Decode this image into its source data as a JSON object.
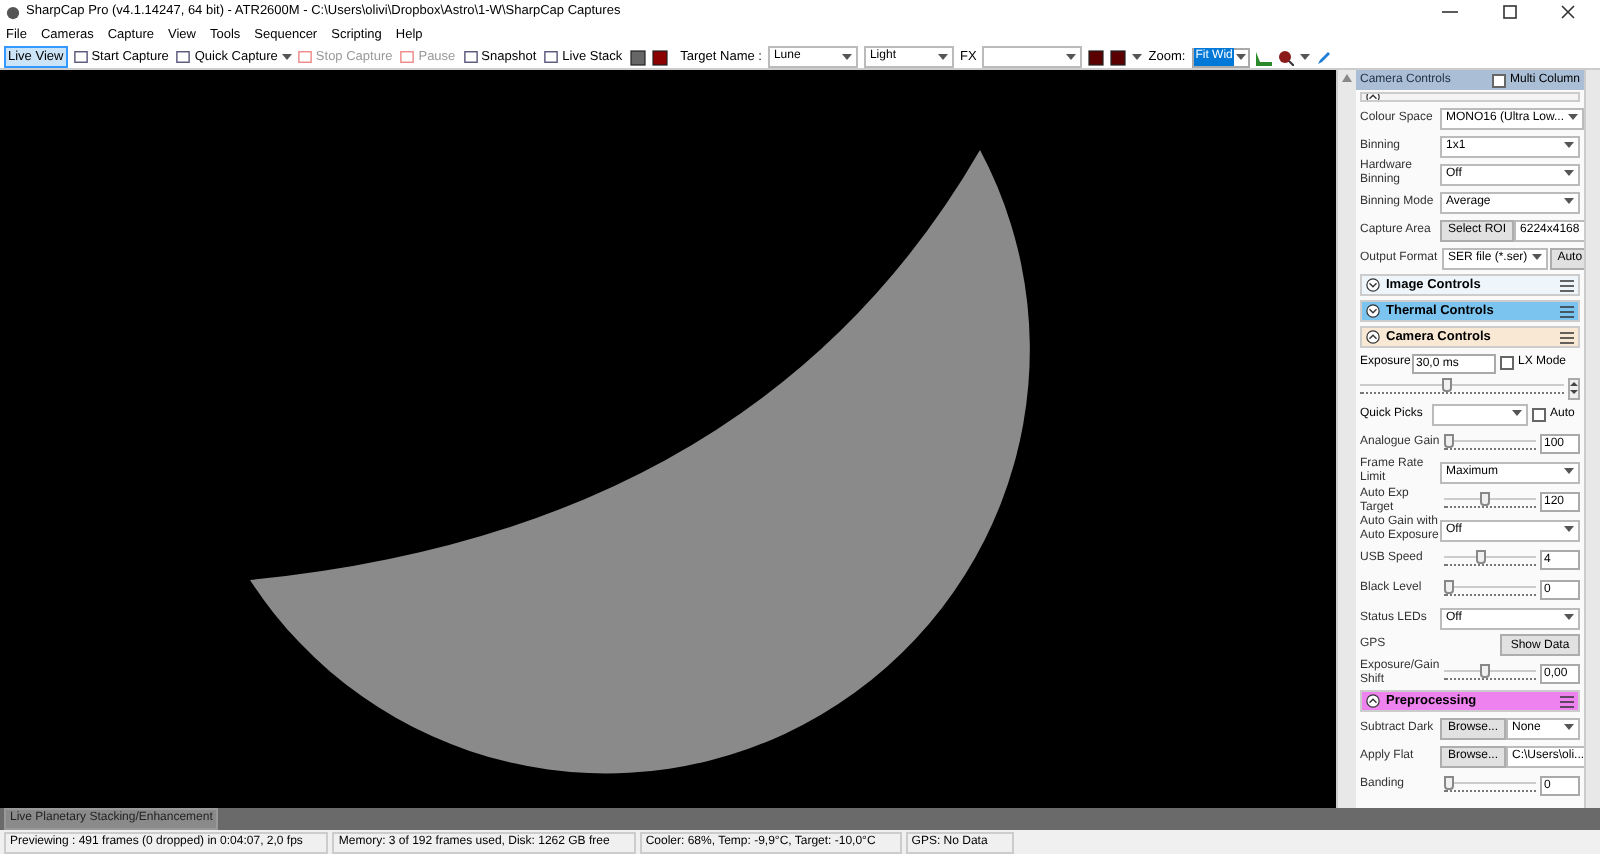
{
  "window": {
    "title": "SharpCap Pro (v4.1.14247, 64 bit) - ATR2600M - C:\\Users\\olivi\\Dropbox\\Astro\\1-W\\SharpCap Captures"
  },
  "menu": [
    "File",
    "Cameras",
    "Capture",
    "View",
    "Tools",
    "Sequencer",
    "Scripting",
    "Help"
  ],
  "toolbar": {
    "items": [
      {
        "kind": "tab",
        "label": "Live View",
        "selected": true,
        "disabled": false
      },
      {
        "kind": "button",
        "label": "Start Capture",
        "disabled": false
      },
      {
        "kind": "dropdown",
        "label": "Quick Capture",
        "disabled": false
      },
      {
        "kind": "button",
        "label": "Stop Capture",
        "disabled": true
      },
      {
        "kind": "button",
        "label": "Pause",
        "disabled": true
      },
      {
        "kind": "button",
        "label": "Snapshot",
        "disabled": false
      },
      {
        "kind": "button",
        "label": "Live Stack",
        "disabled": false
      }
    ],
    "target_label": "Target Name :",
    "target_value": "Lune",
    "frame_type": "Light",
    "fx_label": "FX",
    "zoom_label": "Zoom:",
    "zoom_value": "Fit Wid"
  },
  "panel": {
    "title": "Camera Controls",
    "multi_column": {
      "label": "Multi Column",
      "checked": false
    },
    "rows": [
      {
        "kind": "header",
        "title": "",
        "expanded": true,
        "color": "#f4f4f4"
      },
      {
        "kind": "select",
        "label": "Colour Space",
        "value": "MONO16 (Ultra Low..."
      },
      {
        "kind": "select",
        "label": "Binning",
        "value": "1x1"
      },
      {
        "kind": "select",
        "label": "Hardware Binning",
        "value": "Off"
      },
      {
        "kind": "select",
        "label": "Binning Mode",
        "value": "Average"
      },
      {
        "kind": "button_select",
        "label": "Capture Area",
        "button": "Select ROI",
        "value": "6224x4168"
      },
      {
        "kind": "select_button",
        "label": "Output Format",
        "value": "SER file (*.ser)",
        "button": "Auto"
      },
      {
        "kind": "header",
        "title": "Image Controls",
        "expanded": false,
        "color": "#eef6fc"
      },
      {
        "kind": "header",
        "title": "Thermal Controls",
        "expanded": false,
        "color": "#7cc4f0"
      },
      {
        "kind": "header",
        "title": "Camera Controls",
        "expanded": true,
        "color": "#f8e8d4"
      },
      {
        "kind": "exposure",
        "label": "Exposure",
        "value": "30,0 ms",
        "checkbox_label": "LX Mode",
        "checked": false,
        "level": 0.42
      },
      {
        "kind": "select_check",
        "label": "Quick Picks",
        "checkbox_label": "Auto",
        "checked": false
      },
      {
        "kind": "slider",
        "label": "Analogue Gain",
        "level": 0,
        "value": "100"
      },
      {
        "kind": "select",
        "label": "Frame Rate Limit",
        "value": "Maximum"
      },
      {
        "kind": "slider",
        "label": "Auto Exp Target",
        "level": 0.45,
        "value": "120"
      },
      {
        "kind": "select",
        "label": "Auto Gain with Auto Exposure",
        "value": "Off"
      },
      {
        "kind": "slider",
        "label": "USB Speed",
        "level": 0.4,
        "value": "4"
      },
      {
        "kind": "slider",
        "label": "Black Level",
        "level": 0,
        "value": "0"
      },
      {
        "kind": "select",
        "label": "Status LEDs",
        "value": "Off"
      },
      {
        "kind": "button",
        "label": "GPS",
        "button": "Show Data"
      },
      {
        "kind": "slider",
        "label": "Exposure/Gain Shift",
        "level": 0.45,
        "value": "0,00"
      },
      {
        "kind": "header",
        "title": "Preprocessing",
        "expanded": true,
        "color": "#ee82ee"
      },
      {
        "kind": "button_select",
        "label": "Subtract Dark",
        "button": "Browse...",
        "value": "None"
      },
      {
        "kind": "button_select",
        "label": "Apply Flat",
        "button": "Browse...",
        "value": "C:\\Users\\oli..."
      },
      {
        "kind": "slider",
        "label": "Banding",
        "level": 0,
        "value": "0"
      }
    ]
  },
  "bottom_tab": "Live Planetary Stacking/Enhancement",
  "status_bar": [
    "Previewing : 491 frames (0 dropped) in 0:04:07, 2,0 fps",
    "Memory: 3 of 192 frames used, Disk: 1262 GB free",
    "Cooler: 68%, Temp: -9,9°C, Target: -10,0°C",
    "GPS: No Data"
  ]
}
